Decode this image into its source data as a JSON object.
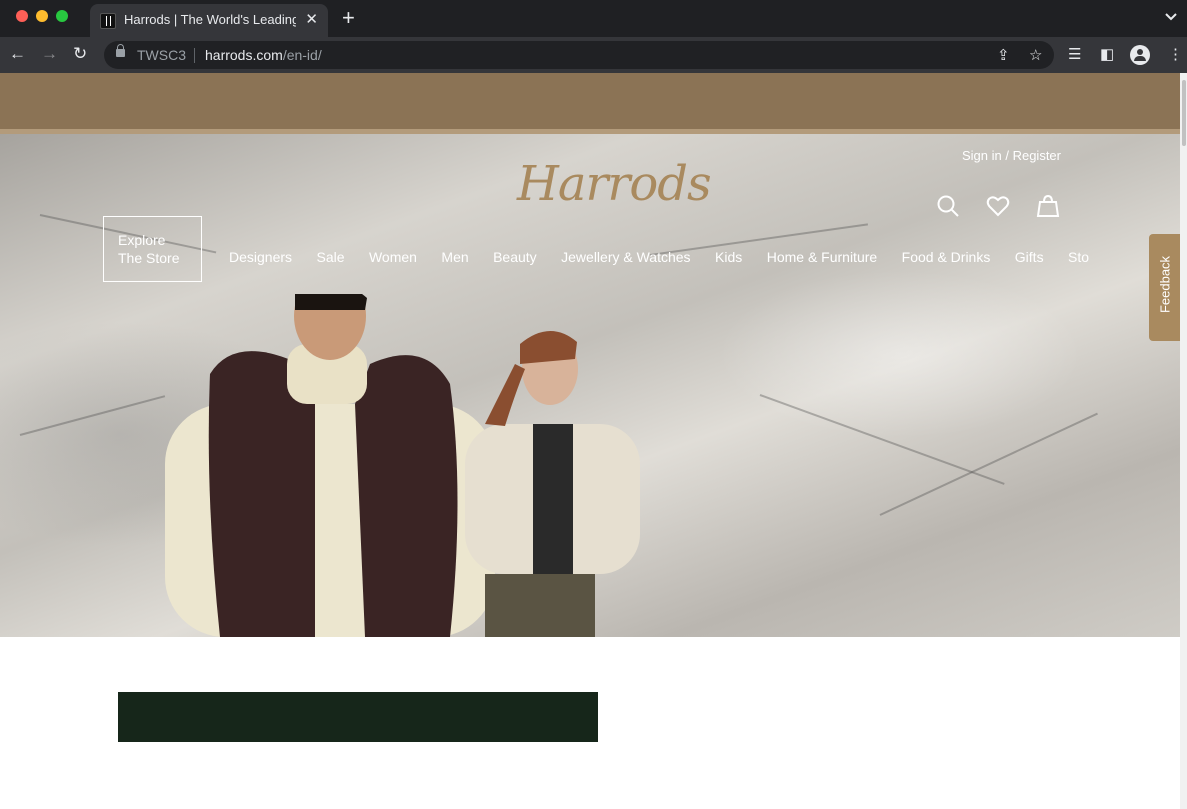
{
  "browser": {
    "tab_title": "Harrods | The World's Leading",
    "tab_close": "✕",
    "new_tab": "+",
    "tab_menu": "⌄",
    "nav": {
      "back": "←",
      "forward": "→",
      "reload": "↻"
    },
    "address_chip": "TWSC3",
    "url_host": "harrods.com",
    "url_path": "/en-id/",
    "icons": [
      "share-icon",
      "bookmark-star-icon",
      "reading-list-icon",
      "side-panel-icon",
      "profile-icon",
      "menu-icon"
    ],
    "glyphs": {
      "share": "⇪",
      "star": "☆",
      "reading_list": "☰",
      "side_panel": "◧",
      "menu": "⋮"
    }
  },
  "site": {
    "signin": "Sign in / Register",
    "logo": "Harrods",
    "explore_line1": "Explore",
    "explore_line2": "The Store",
    "nav": [
      "Designers",
      "Sale",
      "Women",
      "Men",
      "Beauty",
      "Jewellery & Watches",
      "Kids",
      "Home & Furniture",
      "Food & Drinks",
      "Gifts",
      "Sto"
    ],
    "feedback": "Feedback",
    "header_icons": [
      "search-icon",
      "heart-icon",
      "shopping-bag-icon"
    ]
  },
  "colors": {
    "promo_bar": "#8b7355",
    "brand_gold": "#a98a5f",
    "feedback_tab": "#a98a5f",
    "dark_green_block": "#16261a"
  }
}
